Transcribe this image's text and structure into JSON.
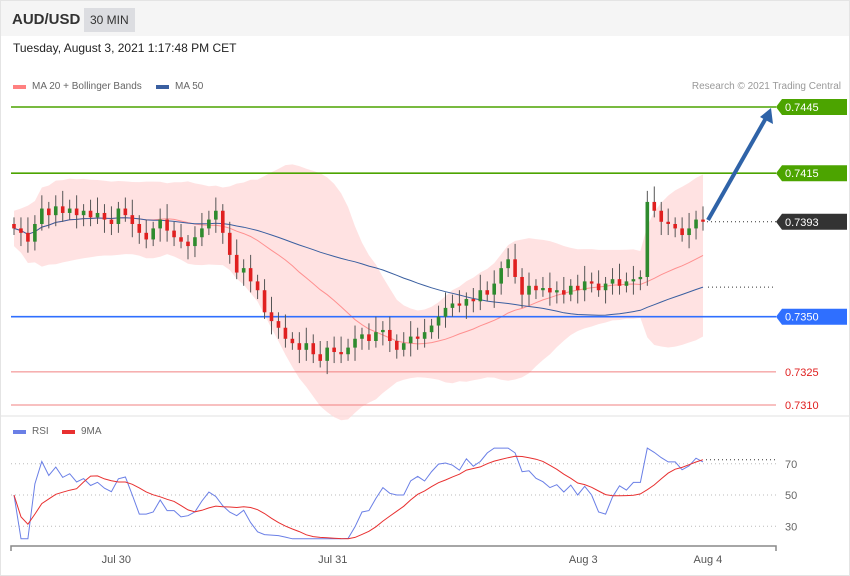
{
  "header": {
    "symbol": "AUD/USD",
    "timeframe": "30 MIN",
    "datetime": "Tuesday, August 3, 2021 1:17:48 PM CET"
  },
  "legend": {
    "ma20": "MA 20 + Bollinger Bands",
    "ma50": "MA 50",
    "rsi": "RSI",
    "rsi_ma": "9MA",
    "copyright": "Research © 2021 Trading Central"
  },
  "colors": {
    "up": "#2e8b2e",
    "down": "#e02020",
    "resistance": "#4ca400",
    "support": "#2f6fff",
    "current": "#333333",
    "red_level": "#f08080",
    "ma50": "#3a5fa0",
    "band": "#ffd8d8",
    "rsi": "#6a7fe6",
    "rsi_ma": "#e83030",
    "arrow": "#2f63a8"
  },
  "levels": [
    {
      "label": "0.7445",
      "value": 0.7445,
      "kind": "resistance"
    },
    {
      "label": "0.7415",
      "value": 0.7415,
      "kind": "resistance"
    },
    {
      "label": "0.7393",
      "value": 0.7393,
      "kind": "current"
    },
    {
      "label": "0.7350",
      "value": 0.735,
      "kind": "support"
    },
    {
      "label": "0.7325",
      "value": 0.7325,
      "kind": "red"
    },
    {
      "label": "0.7310",
      "value": 0.731,
      "kind": "red"
    }
  ],
  "chart_data": {
    "type": "candlestick",
    "title": "AUD/USD 30 MIN",
    "ylim": [
      0.731,
      0.7445
    ],
    "closes": [
      0.739,
      0.7388,
      0.7384,
      0.7392,
      0.7399,
      0.7396,
      0.74,
      0.7397,
      0.7399,
      0.7396,
      0.7398,
      0.7395,
      0.7397,
      0.7394,
      0.7392,
      0.7399,
      0.7396,
      0.7392,
      0.7388,
      0.7385,
      0.739,
      0.7394,
      0.7389,
      0.7386,
      0.7384,
      0.7382,
      0.7386,
      0.739,
      0.7394,
      0.7398,
      0.7388,
      0.7378,
      0.737,
      0.7372,
      0.7366,
      0.7362,
      0.7352,
      0.7348,
      0.7345,
      0.734,
      0.7338,
      0.7335,
      0.7338,
      0.7333,
      0.733,
      0.7336,
      0.7334,
      0.7333,
      0.7336,
      0.734,
      0.7342,
      0.7339,
      0.7343,
      0.7344,
      0.7339,
      0.7335,
      0.7338,
      0.7341,
      0.734,
      0.7343,
      0.7346,
      0.735,
      0.7354,
      0.7356,
      0.7355,
      0.7358,
      0.7357,
      0.7362,
      0.736,
      0.7365,
      0.7372,
      0.7376,
      0.7368,
      0.736,
      0.7364,
      0.7362,
      0.7363,
      0.7361,
      0.7362,
      0.736,
      0.7364,
      0.7362,
      0.7366,
      0.7365,
      0.7362,
      0.7365,
      0.7367,
      0.7364,
      0.7366,
      0.7367,
      0.7368,
      0.7402,
      0.7398,
      0.7393,
      0.7392,
      0.739,
      0.7387,
      0.739,
      0.7394,
      0.7393
    ],
    "open_first": 0.7392,
    "target": 0.7445,
    "x_ticks": [
      {
        "label": "Jul 30",
        "index": 14.7
      },
      {
        "label": "Jul 31",
        "index": 45.8
      },
      {
        "label": "Aug 3",
        "index": 81.8
      },
      {
        "label": "Aug 4",
        "index": 99.7
      }
    ],
    "rsi": {
      "ylim": [
        18,
        82
      ],
      "ticks": [
        {
          "label": "70",
          "value": 70
        },
        {
          "label": "50",
          "value": 50
        },
        {
          "label": "30",
          "value": 30
        }
      ],
      "period": 14,
      "ma_period": 9
    }
  }
}
